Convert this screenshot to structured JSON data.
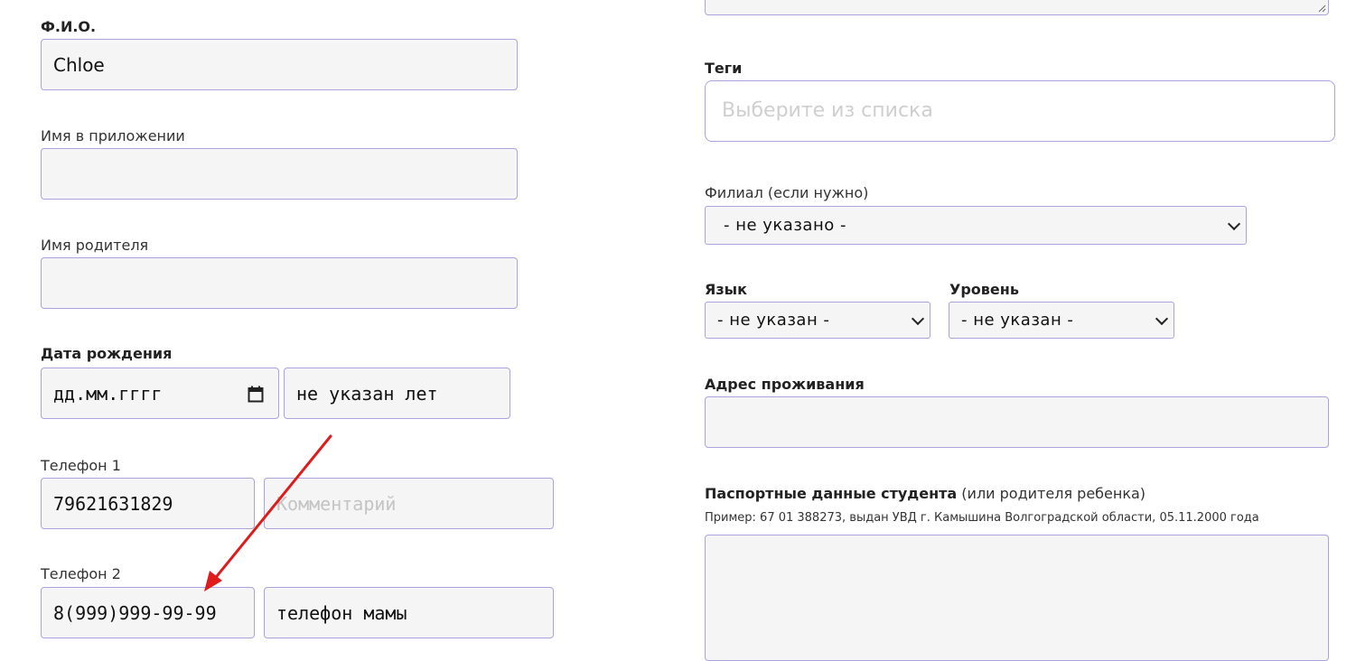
{
  "left": {
    "fio": {
      "label": "Ф.И.О.",
      "value": "Chloe"
    },
    "app_name": {
      "label": "Имя в приложении",
      "value": ""
    },
    "parent_name": {
      "label": "Имя родителя",
      "value": ""
    },
    "birthdate": {
      "label": "Дата рождения",
      "value": "дд.мм.гггг",
      "age": "не указан лет"
    },
    "phone1": {
      "label": "Телефон 1",
      "value": "79621631829",
      "comment_placeholder": "Комментарий"
    },
    "phone2": {
      "label": "Телефон 2",
      "value": "8(999)999-99-99",
      "comment": "телефон мамы"
    }
  },
  "right": {
    "tags": {
      "label": "Теги",
      "placeholder": "Выберите из списка"
    },
    "branch": {
      "label": "Филиал (если нужно)",
      "selected": "- не указано -"
    },
    "language": {
      "label": "Язык",
      "selected": "- не указан -"
    },
    "level": {
      "label": "Уровень",
      "selected": "- не указан -"
    },
    "address": {
      "label": "Адрес проживания",
      "value": ""
    },
    "passport": {
      "label_bold": "Паспортные данные студента",
      "label_rest": "(или родителя ребенка)",
      "example": "Пример: 67 01 388273, выдан УВД г. Камышина Волгоградской области, 05.11.2000 года",
      "value": ""
    }
  },
  "colors": {
    "border": "#a9a4dc",
    "field_bg": "#f5f5f5",
    "arrow": "#e01b1b"
  }
}
